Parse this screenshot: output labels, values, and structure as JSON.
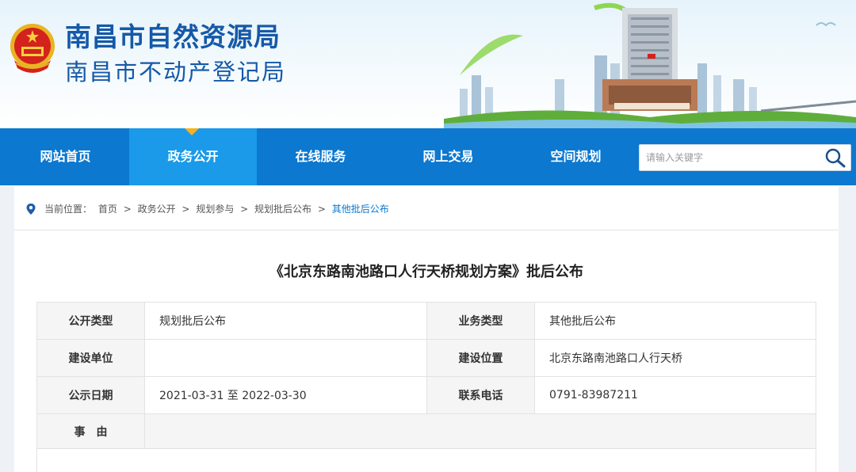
{
  "header": {
    "title": "南昌市自然资源局",
    "subtitle": "南昌市不动产登记局"
  },
  "nav": {
    "items": [
      {
        "label": "网站首页"
      },
      {
        "label": "政务公开"
      },
      {
        "label": "在线服务"
      },
      {
        "label": "网上交易"
      },
      {
        "label": "空间规划"
      }
    ],
    "active_index": 1
  },
  "search": {
    "placeholder": "请输入关键字",
    "value": ""
  },
  "breadcrumb": {
    "prefix": "当前位置：",
    "items": [
      "首页",
      "政务公开",
      "规划参与",
      "规划批后公布"
    ],
    "current": "其他批后公布",
    "separator": ">"
  },
  "article": {
    "title": "《北京东路南池路口人行天桥规划方案》批后公布",
    "fields": {
      "disclosure_type_label": "公开类型",
      "disclosure_type": "规划批后公布",
      "business_type_label": "业务类型",
      "business_type": "其他批后公布",
      "builder_label": "建设单位",
      "builder": "",
      "location_label": "建设位置",
      "location": "北京东路南池路口人行天桥",
      "date_label": "公示日期",
      "date": "2021-03-31 至 2022-03-30",
      "phone_label": "联系电话",
      "phone": "0791-83987211",
      "reason_label": "事　由"
    }
  },
  "colors": {
    "nav_bg": "#0c78cf",
    "nav_active": "#1a9ae8",
    "title_blue": "#1559a8",
    "caret": "#f6b31e"
  },
  "icons": {
    "emblem": "national-emblem-icon",
    "search": "search-icon",
    "location": "location-pin-icon"
  }
}
